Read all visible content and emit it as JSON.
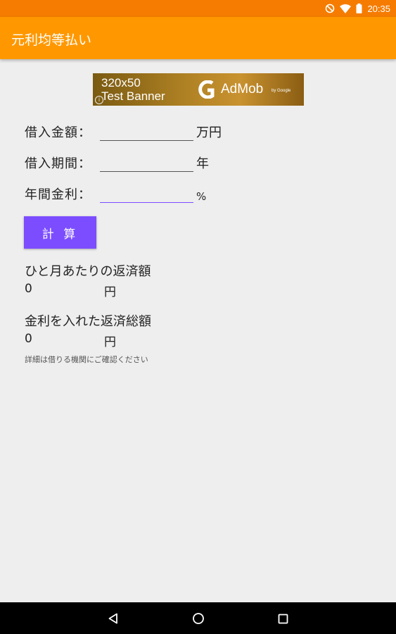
{
  "status_bar": {
    "time": "20:35",
    "icons": [
      "do-not-disturb-icon",
      "wifi-icon",
      "battery-icon"
    ]
  },
  "app_bar": {
    "title": "元利均等払い",
    "color": "#ff9800"
  },
  "ad": {
    "line1": "320x50",
    "line2": "Test Banner",
    "brand": "AdMob",
    "byline": "by Google",
    "info": "i"
  },
  "form": {
    "loan_amount": {
      "label": "借入金額：",
      "value": "",
      "unit": "万円"
    },
    "loan_period": {
      "label": "借入期間：",
      "value": "",
      "unit": "年"
    },
    "interest_rate": {
      "label": "年間金利：",
      "value": "",
      "unit": "%"
    }
  },
  "calculate_button": {
    "label": "計 算",
    "color": "#7c4dff"
  },
  "results": {
    "monthly": {
      "label": "ひと月あたりの返済額",
      "value": "0",
      "unit": "円"
    },
    "total": {
      "label": "金利を入れた返済総額",
      "value": "0",
      "unit": "円"
    }
  },
  "note": "詳細は借りる機関にご確認ください",
  "nav_bar": {
    "buttons": [
      "back-icon",
      "home-icon",
      "recents-icon"
    ]
  }
}
